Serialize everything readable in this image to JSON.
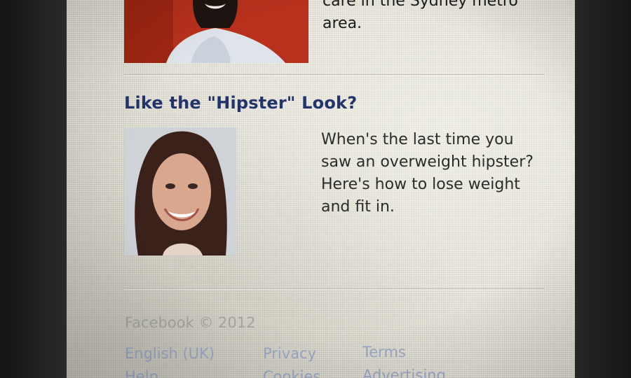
{
  "ads": [
    {
      "title": "",
      "body": "care in the Sydney metro area.",
      "image_icon": "woman-portrait-red-background"
    },
    {
      "title": "Like the \"Hipster\" Look?",
      "body": "When's the last time you saw an overweight hipster? Here's how to lose weight and fit in.",
      "image_icon": "smiling-woman-portrait"
    }
  ],
  "footer": {
    "copyright": "Facebook © 2012",
    "links": {
      "language": "English (UK)",
      "privacy": "Privacy",
      "terms": "Terms",
      "help": "Help",
      "cookies": "Cookies",
      "advertising": "Advertising"
    }
  },
  "colors": {
    "title": "#23346b",
    "body_text": "#2c2c2c",
    "footer_text": "#a4a4a4",
    "footer_link": "#9aa7c6",
    "ad1_image_bg": "#b8311c",
    "background": "#e9e7dc"
  }
}
